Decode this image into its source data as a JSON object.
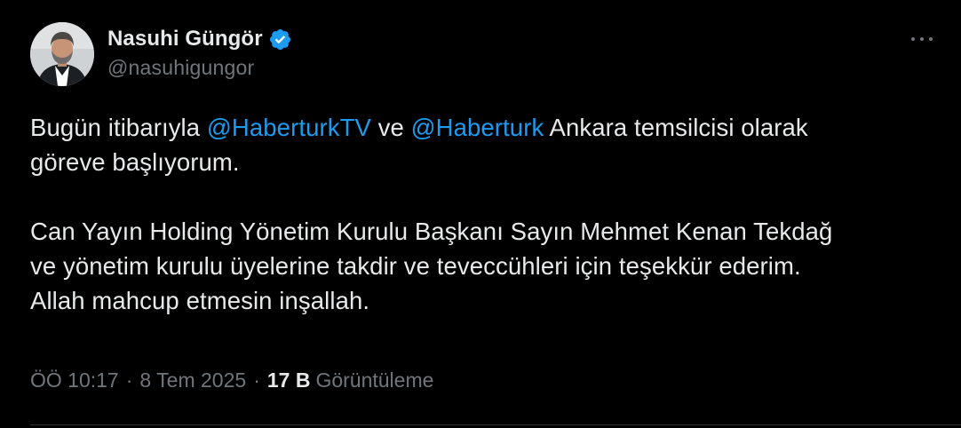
{
  "colors": {
    "background": "#000000",
    "text_primary": "#e7e9ea",
    "text_secondary": "#71767b",
    "accent": "#1d9bf0",
    "verified_badge": "#1d9bf0"
  },
  "author": {
    "display_name": "Nasuhi Güngör",
    "handle": "@nasuhigungor",
    "verified": true,
    "verified_icon": "verified-badge-icon",
    "avatar_icon": "profile-avatar"
  },
  "more_menu": {
    "icon": "more-options-icon"
  },
  "tweet": {
    "line1": {
      "before": "Bugün itibarıyla ",
      "mention1": "@HaberturkTV",
      "between": " ve ",
      "mention2": "@Haberturk",
      "after": " Ankara temsilcisi olarak"
    },
    "line2": "göreve başlıyorum.",
    "line3": "Can Yayın Holding Yönetim Kurulu Başkanı Sayın Mehmet Kenan Tekdağ",
    "line4": "ve yönetim kurulu üyelerine takdir ve teveccühleri için teşekkür ederim.",
    "line5": "Allah mahcup etmesin inşallah."
  },
  "meta": {
    "time": "ÖÖ 10:17",
    "separator": "·",
    "date": "8 Tem 2025",
    "views_count": "17 B",
    "views_label": "Görüntüleme"
  }
}
